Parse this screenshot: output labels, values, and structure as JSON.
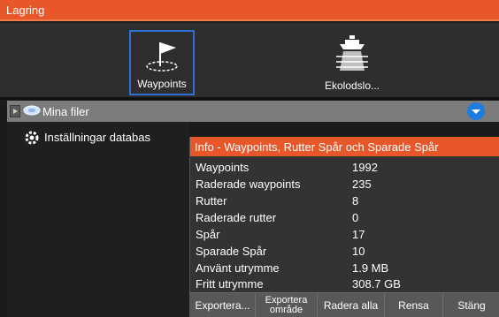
{
  "window": {
    "title": "Lagring"
  },
  "tiles": [
    {
      "label": "Waypoints",
      "icon": "waypoint-flag-icon",
      "selected": true
    },
    {
      "label": "Ekolodslo...",
      "icon": "echosounder-log-icon",
      "selected": false
    }
  ],
  "files": {
    "label": "Mina filer",
    "icon": "disk-icon"
  },
  "database": {
    "label": "Inställningar databas",
    "icon": "settings-gear-icon"
  },
  "info_dialog": {
    "title": "Info - Waypoints, Rutter Spår och Sparade Spår",
    "rows": [
      {
        "key": "Waypoints",
        "value": "1992"
      },
      {
        "key": "Raderade waypoints",
        "value": "235"
      },
      {
        "key": "Rutter",
        "value": "8"
      },
      {
        "key": "Raderade rutter",
        "value": "0"
      },
      {
        "key": "Spår",
        "value": "17"
      },
      {
        "key": "Sparade Spår",
        "value": "10"
      },
      {
        "key": "Använt utrymme",
        "value": "1.9 MB"
      },
      {
        "key": "Fritt utrymme",
        "value": "308.7 GB"
      }
    ],
    "buttons": {
      "export": "Exportera...",
      "export_area_1": "Exportera",
      "export_area_2": "område",
      "delete_all": "Radera alla",
      "clear": "Rensa",
      "close": "Stäng"
    }
  },
  "colors": {
    "accent": "#e8572a",
    "selection": "#2c6fd6",
    "dropdown": "#1e7be0"
  }
}
